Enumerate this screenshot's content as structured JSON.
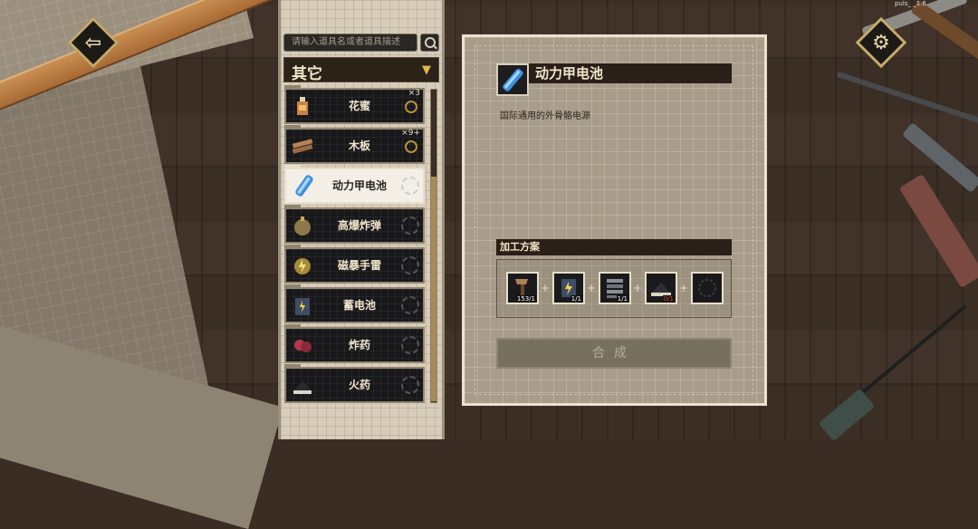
{
  "debug_label": "puls_  _1.6",
  "search": {
    "placeholder": "请输入道具名或者道具描述"
  },
  "category": {
    "label": "其它"
  },
  "items": [
    {
      "name": "花蜜",
      "count": "×3",
      "selected": false
    },
    {
      "name": "木板",
      "count": "×9+",
      "selected": false
    },
    {
      "name": "动力甲电池",
      "count": "",
      "selected": true
    },
    {
      "name": "高爆炸弹",
      "count": "",
      "selected": false
    },
    {
      "name": "磁暴手雷",
      "count": "",
      "selected": false
    },
    {
      "name": "蓄电池",
      "count": "",
      "selected": false
    },
    {
      "name": "炸药",
      "count": "",
      "selected": false
    },
    {
      "name": "火药",
      "count": "",
      "selected": false
    }
  ],
  "detail": {
    "title": "动力甲电池",
    "description": "国际通用的外骨骼电源",
    "recipe_header": "加工方案",
    "ingredients": [
      {
        "qty": "153/1",
        "short": false,
        "icon": "hammer-icon"
      },
      {
        "qty": "1/1",
        "short": false,
        "icon": "battery-icon"
      },
      {
        "qty": "1/1",
        "short": false,
        "icon": "coil-icon"
      },
      {
        "qty": "0/1",
        "short": true,
        "icon": "gunpowder-icon"
      },
      {
        "qty": "",
        "short": false,
        "icon": "empty-slot-icon"
      }
    ],
    "craft_label": "合成"
  },
  "colors": {
    "accent": "#e2b646",
    "panel": "#a89c8a",
    "dark_bar": "#2a2019",
    "shortage": "#e04b3a"
  }
}
